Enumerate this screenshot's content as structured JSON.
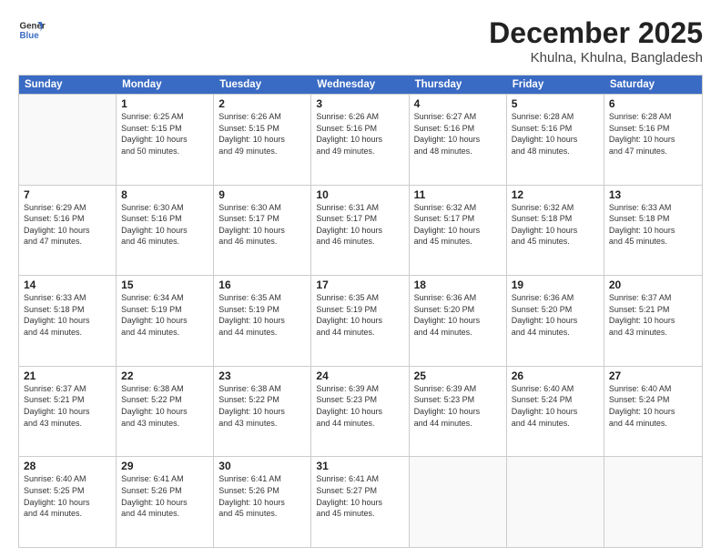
{
  "logo": {
    "line1": "General",
    "line2": "Blue"
  },
  "title": "December 2025",
  "subtitle": "Khulna, Khulna, Bangladesh",
  "header_days": [
    "Sunday",
    "Monday",
    "Tuesday",
    "Wednesday",
    "Thursday",
    "Friday",
    "Saturday"
  ],
  "weeks": [
    [
      {
        "day": "",
        "info": ""
      },
      {
        "day": "1",
        "info": "Sunrise: 6:25 AM\nSunset: 5:15 PM\nDaylight: 10 hours\nand 50 minutes."
      },
      {
        "day": "2",
        "info": "Sunrise: 6:26 AM\nSunset: 5:15 PM\nDaylight: 10 hours\nand 49 minutes."
      },
      {
        "day": "3",
        "info": "Sunrise: 6:26 AM\nSunset: 5:16 PM\nDaylight: 10 hours\nand 49 minutes."
      },
      {
        "day": "4",
        "info": "Sunrise: 6:27 AM\nSunset: 5:16 PM\nDaylight: 10 hours\nand 48 minutes."
      },
      {
        "day": "5",
        "info": "Sunrise: 6:28 AM\nSunset: 5:16 PM\nDaylight: 10 hours\nand 48 minutes."
      },
      {
        "day": "6",
        "info": "Sunrise: 6:28 AM\nSunset: 5:16 PM\nDaylight: 10 hours\nand 47 minutes."
      }
    ],
    [
      {
        "day": "7",
        "info": "Sunrise: 6:29 AM\nSunset: 5:16 PM\nDaylight: 10 hours\nand 47 minutes."
      },
      {
        "day": "8",
        "info": "Sunrise: 6:30 AM\nSunset: 5:16 PM\nDaylight: 10 hours\nand 46 minutes."
      },
      {
        "day": "9",
        "info": "Sunrise: 6:30 AM\nSunset: 5:17 PM\nDaylight: 10 hours\nand 46 minutes."
      },
      {
        "day": "10",
        "info": "Sunrise: 6:31 AM\nSunset: 5:17 PM\nDaylight: 10 hours\nand 46 minutes."
      },
      {
        "day": "11",
        "info": "Sunrise: 6:32 AM\nSunset: 5:17 PM\nDaylight: 10 hours\nand 45 minutes."
      },
      {
        "day": "12",
        "info": "Sunrise: 6:32 AM\nSunset: 5:18 PM\nDaylight: 10 hours\nand 45 minutes."
      },
      {
        "day": "13",
        "info": "Sunrise: 6:33 AM\nSunset: 5:18 PM\nDaylight: 10 hours\nand 45 minutes."
      }
    ],
    [
      {
        "day": "14",
        "info": "Sunrise: 6:33 AM\nSunset: 5:18 PM\nDaylight: 10 hours\nand 44 minutes."
      },
      {
        "day": "15",
        "info": "Sunrise: 6:34 AM\nSunset: 5:19 PM\nDaylight: 10 hours\nand 44 minutes."
      },
      {
        "day": "16",
        "info": "Sunrise: 6:35 AM\nSunset: 5:19 PM\nDaylight: 10 hours\nand 44 minutes."
      },
      {
        "day": "17",
        "info": "Sunrise: 6:35 AM\nSunset: 5:19 PM\nDaylight: 10 hours\nand 44 minutes."
      },
      {
        "day": "18",
        "info": "Sunrise: 6:36 AM\nSunset: 5:20 PM\nDaylight: 10 hours\nand 44 minutes."
      },
      {
        "day": "19",
        "info": "Sunrise: 6:36 AM\nSunset: 5:20 PM\nDaylight: 10 hours\nand 44 minutes."
      },
      {
        "day": "20",
        "info": "Sunrise: 6:37 AM\nSunset: 5:21 PM\nDaylight: 10 hours\nand 43 minutes."
      }
    ],
    [
      {
        "day": "21",
        "info": "Sunrise: 6:37 AM\nSunset: 5:21 PM\nDaylight: 10 hours\nand 43 minutes."
      },
      {
        "day": "22",
        "info": "Sunrise: 6:38 AM\nSunset: 5:22 PM\nDaylight: 10 hours\nand 43 minutes."
      },
      {
        "day": "23",
        "info": "Sunrise: 6:38 AM\nSunset: 5:22 PM\nDaylight: 10 hours\nand 43 minutes."
      },
      {
        "day": "24",
        "info": "Sunrise: 6:39 AM\nSunset: 5:23 PM\nDaylight: 10 hours\nand 44 minutes."
      },
      {
        "day": "25",
        "info": "Sunrise: 6:39 AM\nSunset: 5:23 PM\nDaylight: 10 hours\nand 44 minutes."
      },
      {
        "day": "26",
        "info": "Sunrise: 6:40 AM\nSunset: 5:24 PM\nDaylight: 10 hours\nand 44 minutes."
      },
      {
        "day": "27",
        "info": "Sunrise: 6:40 AM\nSunset: 5:24 PM\nDaylight: 10 hours\nand 44 minutes."
      }
    ],
    [
      {
        "day": "28",
        "info": "Sunrise: 6:40 AM\nSunset: 5:25 PM\nDaylight: 10 hours\nand 44 minutes."
      },
      {
        "day": "29",
        "info": "Sunrise: 6:41 AM\nSunset: 5:26 PM\nDaylight: 10 hours\nand 44 minutes."
      },
      {
        "day": "30",
        "info": "Sunrise: 6:41 AM\nSunset: 5:26 PM\nDaylight: 10 hours\nand 45 minutes."
      },
      {
        "day": "31",
        "info": "Sunrise: 6:41 AM\nSunset: 5:27 PM\nDaylight: 10 hours\nand 45 minutes."
      },
      {
        "day": "",
        "info": ""
      },
      {
        "day": "",
        "info": ""
      },
      {
        "day": "",
        "info": ""
      }
    ]
  ]
}
